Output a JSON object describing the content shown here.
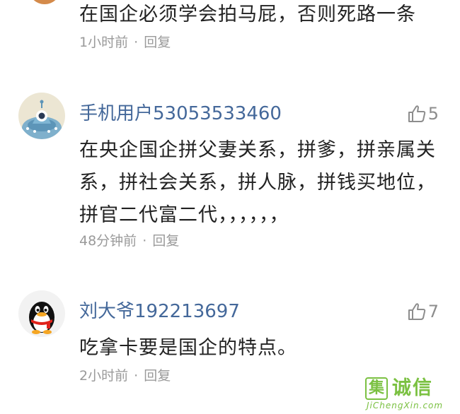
{
  "comments": [
    {
      "text": "在国企必须学会拍马屁，否则死路一条",
      "time": "1小时前",
      "separator": "·",
      "reply_label": "回复"
    },
    {
      "username": "手机用户53053533460",
      "likes": "5",
      "text": "在央企国企拼父妻关系，拼爹，拼亲属关系，拼社会关系，拼人脉，拼钱买地位，拼官二代富二代，，，，，，",
      "time": "48分钟前",
      "separator": "·",
      "reply_label": "回复",
      "avatar_icon": "alien-ufo-icon"
    },
    {
      "username": "刘大爷192213697",
      "likes": "7",
      "text": "吃拿卡要是国企的特点。",
      "time": "2小时前",
      "separator": "·",
      "reply_label": "回复",
      "avatar_icon": "penguin-icon"
    }
  ],
  "watermark": {
    "logo_char": "集",
    "brand": "诚信",
    "url": "JiChengXin.com"
  },
  "colors": {
    "username": "#44689a",
    "body": "#222222",
    "meta": "#9a9a9a",
    "like": "#8d8d8d",
    "watermark": "#7bc142"
  },
  "icons": {
    "like": "thumbs-up-icon"
  }
}
